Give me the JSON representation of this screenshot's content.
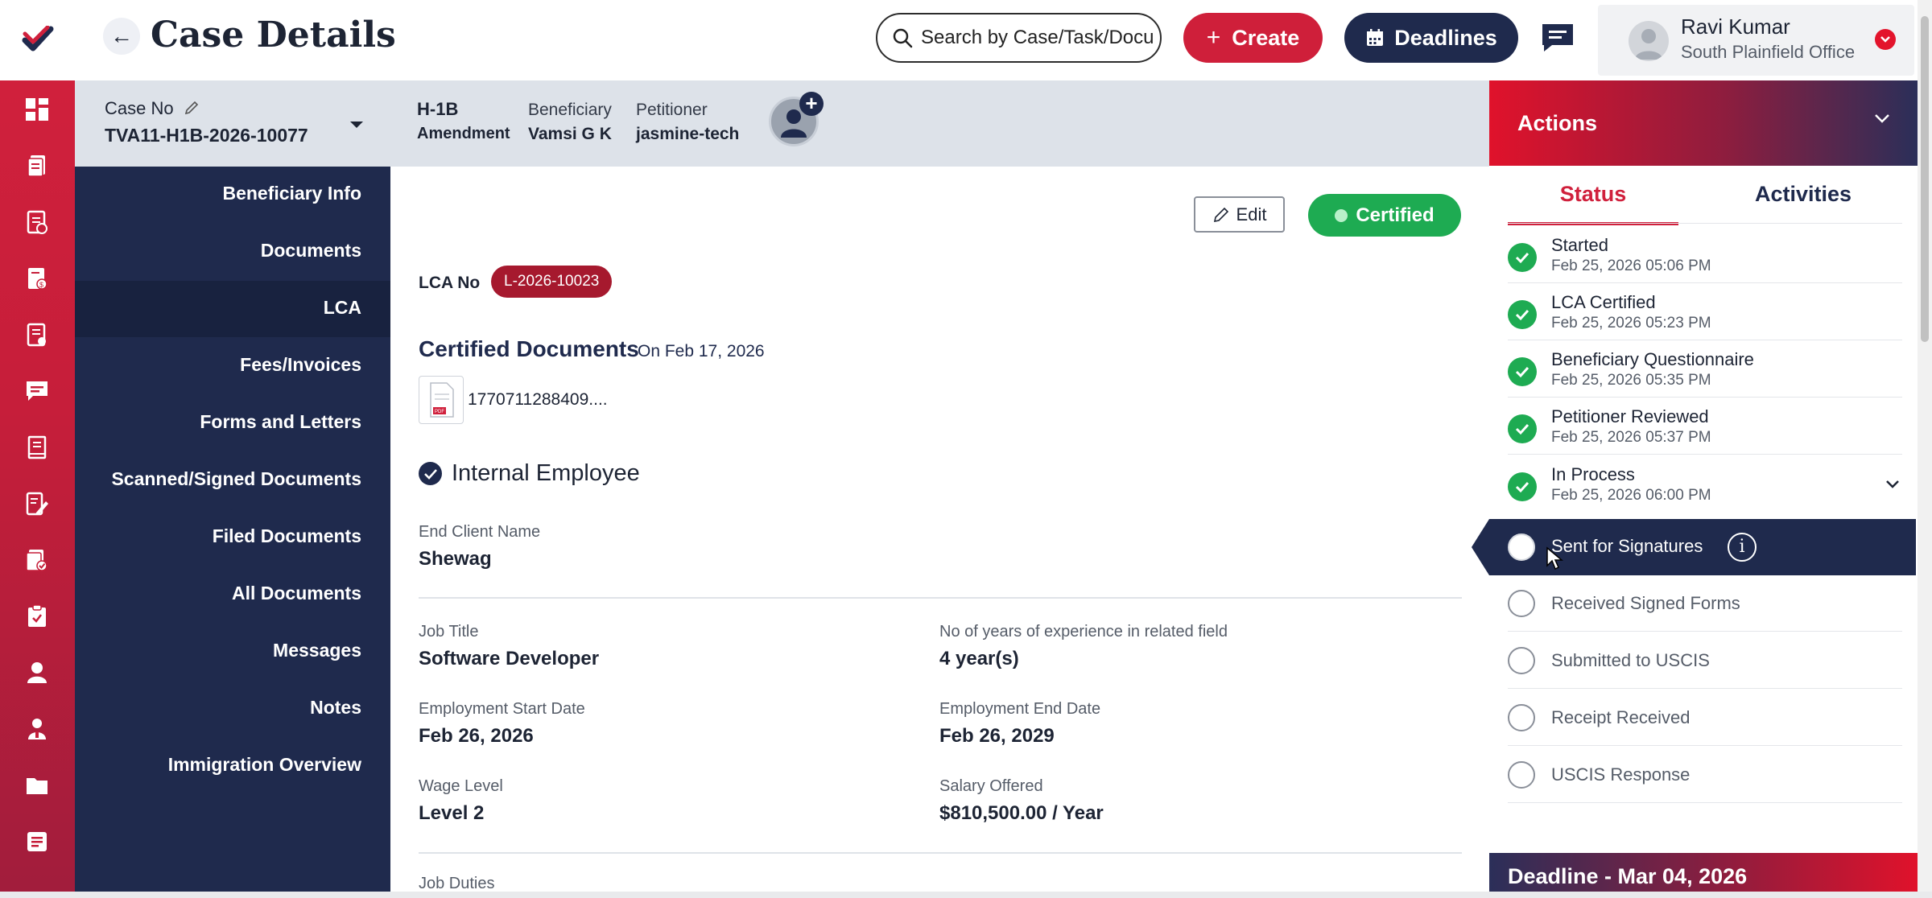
{
  "header": {
    "title": "Case Details",
    "search_placeholder": "Search by Case/Task/Document",
    "create_label": "Create",
    "deadlines_label": "Deadlines",
    "user_name": "Ravi Kumar",
    "user_office": "South Plainfield Office"
  },
  "case": {
    "case_no_label": "Case No",
    "case_no": "TVA11-H1B-2026-10077",
    "visa_type": "H-1B",
    "visa_subtype": "Amendment",
    "beneficiary_label": "Beneficiary",
    "beneficiary": "Vamsi G K",
    "petitioner_label": "Petitioner",
    "petitioner": "jasmine-tech"
  },
  "sidenav": {
    "items": [
      "Beneficiary Info",
      "Documents",
      "LCA",
      "Fees/Invoices",
      "Forms and Letters",
      "Scanned/Signed Documents",
      "Filed Documents",
      "All Documents",
      "Messages",
      "Notes",
      "Immigration Overview"
    ],
    "active": "LCA"
  },
  "main": {
    "edit_label": "Edit",
    "status_label": "Certified",
    "lca_no_label": "LCA No",
    "lca_no": "L-2026-10023",
    "cert_docs_title": "Certified Documents",
    "cert_docs_date": "On Feb 17, 2026",
    "file_name": "1770711288409....",
    "employee_type": "Internal Employee",
    "end_client_label": "End Client Name",
    "end_client": "Shewag",
    "job_title_label": "Job Title",
    "job_title": "Software Developer",
    "experience_label": "No of years of experience in related field",
    "experience": "4 year(s)",
    "start_date_label": "Employment Start Date",
    "start_date": "Feb 26, 2026",
    "end_date_label": "Employment End Date",
    "end_date": "Feb 26, 2029",
    "wage_level_label": "Wage Level",
    "wage_level": "Level 2",
    "salary_label": "Salary Offered",
    "salary": "$810,500.00 / Year",
    "job_duties_label": "Job Duties"
  },
  "actions": {
    "title": "Actions",
    "tab_status": "Status",
    "tab_activities": "Activities",
    "completed": [
      {
        "title": "Started",
        "date": "Feb 25, 2026 05:06 PM"
      },
      {
        "title": "LCA Certified",
        "date": "Feb 25, 2026 05:23 PM"
      },
      {
        "title": "Beneficiary Questionnaire",
        "date": "Feb 25, 2026 05:35 PM"
      },
      {
        "title": "Petitioner Reviewed",
        "date": "Feb 25, 2026 05:37 PM"
      },
      {
        "title": "In Process",
        "date": "Feb 25, 2026 06:00 PM"
      }
    ],
    "current": "Sent for Signatures",
    "pending": [
      "Received Signed Forms",
      "Submitted to USCIS",
      "Receipt Received",
      "USCIS Response"
    ],
    "deadline": "Deadline - Mar 04, 2026"
  },
  "colors": {
    "brand_red": "#d0203c",
    "navy": "#1f2a4d",
    "success_green": "#1eab52"
  }
}
